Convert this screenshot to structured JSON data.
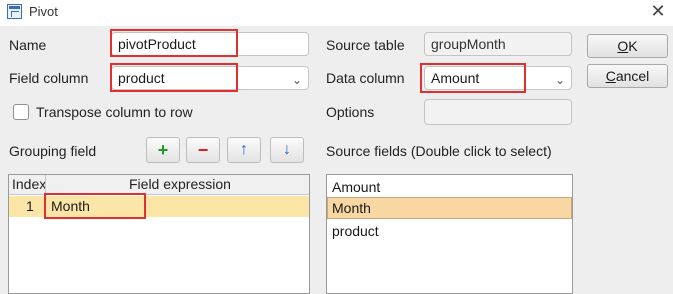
{
  "window": {
    "title": "Pivot",
    "close_glyph": "✕"
  },
  "labels": {
    "name": "Name",
    "field_column": "Field column",
    "transpose": "Transpose column to row",
    "grouping_field": "Grouping field",
    "source_table": "Source table",
    "data_column": "Data column",
    "options": "Options",
    "source_fields": "Source fields (Double click to select)"
  },
  "values": {
    "name": "pivotProduct",
    "field_column": "product",
    "source_table": "groupMonth",
    "data_column": "Amount",
    "options": ""
  },
  "buttons": {
    "ok": "OK",
    "ok_mnemonic": "O",
    "ok_rest": "K",
    "cancel": "Cancel",
    "cancel_mnemonic": "C",
    "cancel_rest": "ancel"
  },
  "toolbar": {
    "add": "+",
    "remove": "−",
    "up": "↑",
    "down": "↓"
  },
  "grouping_table": {
    "columns": [
      "Index",
      "Field expression"
    ],
    "rows": [
      {
        "index": "1",
        "expression": "Month"
      }
    ]
  },
  "source_fields": [
    "Amount",
    "Month",
    "product"
  ],
  "colors": {
    "highlight": "#e03030",
    "selected_row": "#fbe6a7",
    "selected_list": "#f9d7a3"
  }
}
